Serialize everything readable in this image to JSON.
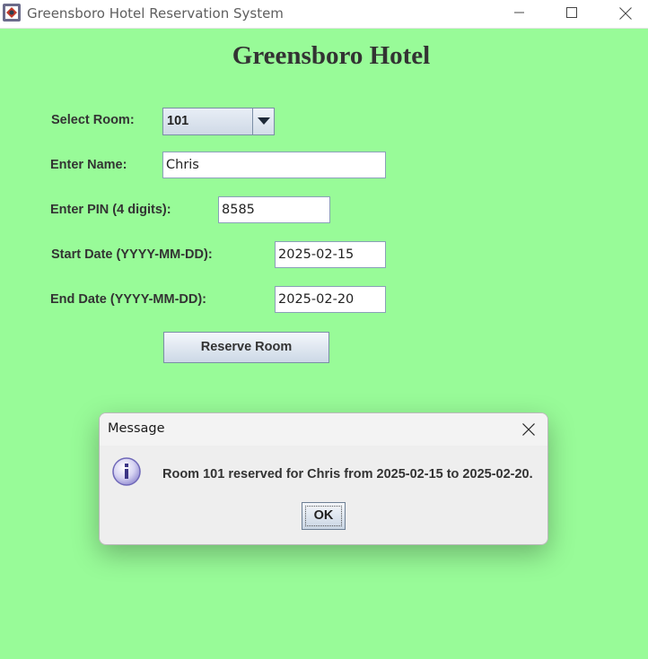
{
  "window": {
    "title": "Greensboro Hotel Reservation System",
    "minimize_icon": "minimize-icon",
    "maximize_icon": "maximize-icon",
    "close_icon": "close-icon",
    "app_icon": "java-app-icon"
  },
  "form": {
    "heading": "Greensboro Hotel",
    "room_label": "Select Room:",
    "room_value": "101",
    "name_label": "Enter Name:",
    "name_value": "Chris",
    "pin_label": "Enter PIN (4 digits):",
    "pin_value": "8585",
    "start_label": "Start Date (YYYY-MM-DD):",
    "start_value": "2025-02-15",
    "end_label": "End Date (YYYY-MM-DD):",
    "end_value": "2025-02-20",
    "reserve_button": "Reserve Room"
  },
  "dialog": {
    "title": "Message",
    "message": "Room 101 reserved for Chris from 2025-02-15 to 2025-02-20.",
    "ok_button": "OK",
    "icon": "info-icon"
  },
  "colors": {
    "background": "#98fb98",
    "text": "#333333",
    "dialog_bg": "#eeeeee"
  }
}
